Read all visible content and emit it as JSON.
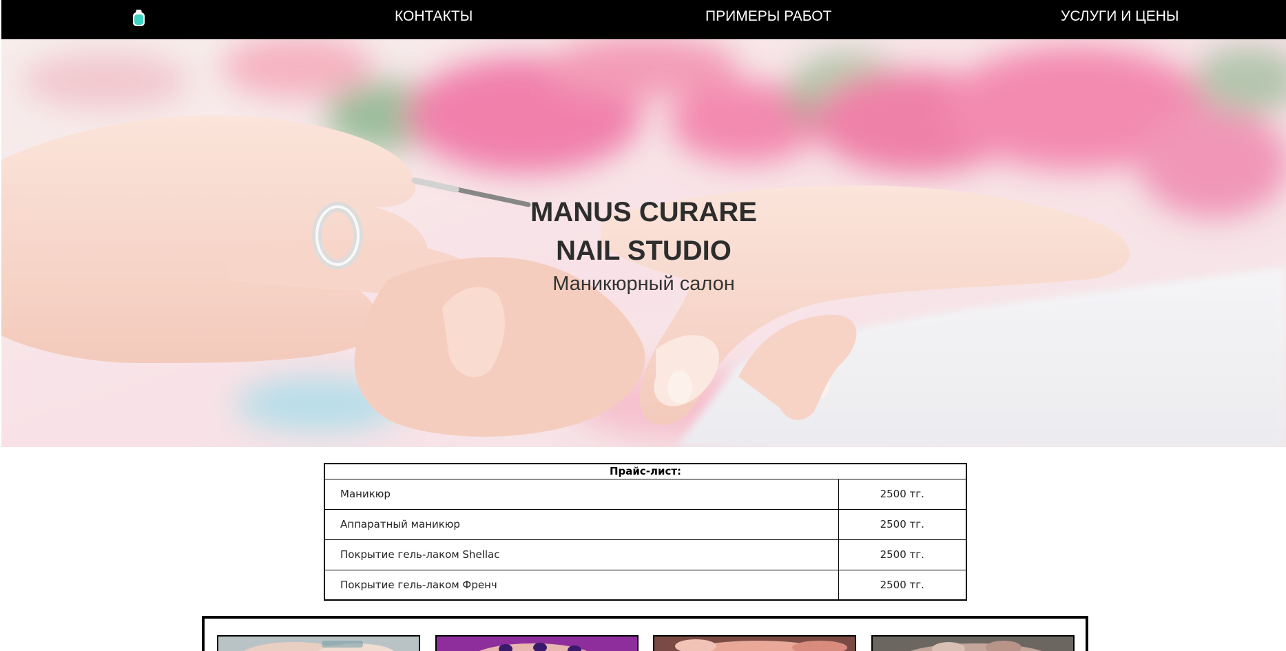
{
  "nav": {
    "logo_icon": "nail-polish-icon",
    "links": [
      {
        "label": "КОНТАКТЫ"
      },
      {
        "label": "ПРИМЕРЫ РАБОТ"
      },
      {
        "label": "УСЛУГИ И ЦЕНЫ"
      }
    ]
  },
  "hero": {
    "title_line1": "MANUS CURARE",
    "title_line2": "NAIL STUDIO",
    "subtitle": "Маникюрный салон"
  },
  "price_list": {
    "header": "Прайс-лист:",
    "rows": [
      {
        "service": "Маникюр",
        "price": "2500 тг."
      },
      {
        "service": "Аппаратный маникюр",
        "price": "2500 тг."
      },
      {
        "service": "Покрытие гель-лаком Shellac",
        "price": "2500 тг."
      },
      {
        "service": "Покрытие гель-лаком Френч",
        "price": "2500 тг."
      }
    ]
  },
  "gallery": {
    "items": [
      {
        "icon": "manicure-photo"
      },
      {
        "icon": "manicure-photo"
      },
      {
        "icon": "manicure-photo"
      },
      {
        "icon": "manicure-photo"
      }
    ]
  },
  "colors": {
    "nav_background": "#000000",
    "nav_text": "#ffffff",
    "hero_text": "#2d2d2d",
    "logo_accent": "#3fd3c3",
    "table_border": "#000000"
  }
}
